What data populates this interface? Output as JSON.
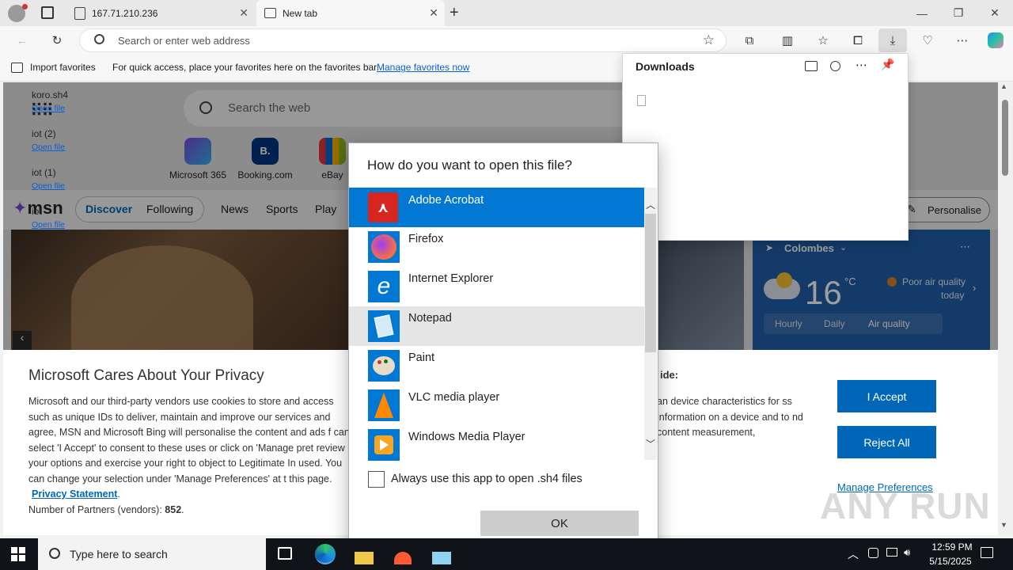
{
  "browser": {
    "tabs": [
      {
        "label": "167.71.210.236"
      },
      {
        "label": "New tab"
      }
    ],
    "address_placeholder": "Search or enter web address",
    "favbar": {
      "import_label": "Import favorites",
      "hint": "For quick access, place your favorites here on the favorites bar.",
      "manage_link": "Manage favorites now"
    }
  },
  "msn": {
    "search_placeholder": "Search the web",
    "tiles": [
      {
        "label": "Microsoft 365"
      },
      {
        "label": "Booking.com"
      },
      {
        "label": "eBay"
      }
    ],
    "logo": "msn",
    "nav": [
      "Discover",
      "Following",
      "News",
      "Sports",
      "Play"
    ],
    "personalise": "Personalise",
    "weather": {
      "location": "Colombes",
      "temp": "16",
      "unit": "°C",
      "air": "Poor air quality",
      "air_sub": "today",
      "tabs": [
        "Hourly",
        "Daily",
        "Air quality"
      ]
    }
  },
  "privacy": {
    "title": "Microsoft Cares About Your Privacy",
    "body": "Microsoft and our third-party vendors use cookies to store and access such as unique IDs to deliver, maintain and improve our services and agree, MSN and Microsoft Bing will personalise the content and ads f can select 'I Accept' to consent to these uses or click on 'Manage pret review your options and exercise your right to object to Legitimate In used. You can change your selection under 'Manage Preferences' at t this page.",
    "privacy_link": "Privacy Statement",
    "partners_label": "Number of Partners (vendors):",
    "partners_count": "852",
    "right_head": "ide:",
    "right_body": "an device characteristics for ss information on a device and to nd content measurement,",
    "accept": "I Accept",
    "reject": "Reject All",
    "manage": "Manage Preferences"
  },
  "downloads": {
    "title": "Downloads",
    "items": [
      {
        "name": "koro.sh4",
        "action": "Open file"
      },
      {
        "name": "iot (2)",
        "action": "Open file"
      },
      {
        "name": "iot (1)",
        "action": "Open file"
      },
      {
        "name": "iot",
        "action": "Open file"
      }
    ]
  },
  "dialog": {
    "title": "How do you want to open this file?",
    "apps": [
      {
        "label": "Adobe Acrobat",
        "icon": "adobe-acrobat-icon",
        "state": "selected"
      },
      {
        "label": "Firefox",
        "icon": "firefox-icon",
        "state": "normal"
      },
      {
        "label": "Internet Explorer",
        "icon": "internet-explorer-icon",
        "state": "normal"
      },
      {
        "label": "Notepad",
        "icon": "notepad-icon",
        "state": "hover"
      },
      {
        "label": "Paint",
        "icon": "paint-icon",
        "state": "normal"
      },
      {
        "label": "VLC media player",
        "icon": "vlc-icon",
        "state": "normal"
      },
      {
        "label": "Windows Media Player",
        "icon": "windows-media-player-icon",
        "state": "normal"
      }
    ],
    "always_label": "Always use this app to open .sh4 files",
    "ok_label": "OK"
  },
  "taskbar": {
    "search_placeholder": "Type here to search",
    "time": "12:59 PM",
    "date": "5/15/2025"
  },
  "watermark": "ANY RUN",
  "colors": {
    "accent": "#0078d4",
    "msn_button": "#0067b8",
    "selected_row": "#0078d4",
    "hover_row": "#e5e5e5"
  }
}
